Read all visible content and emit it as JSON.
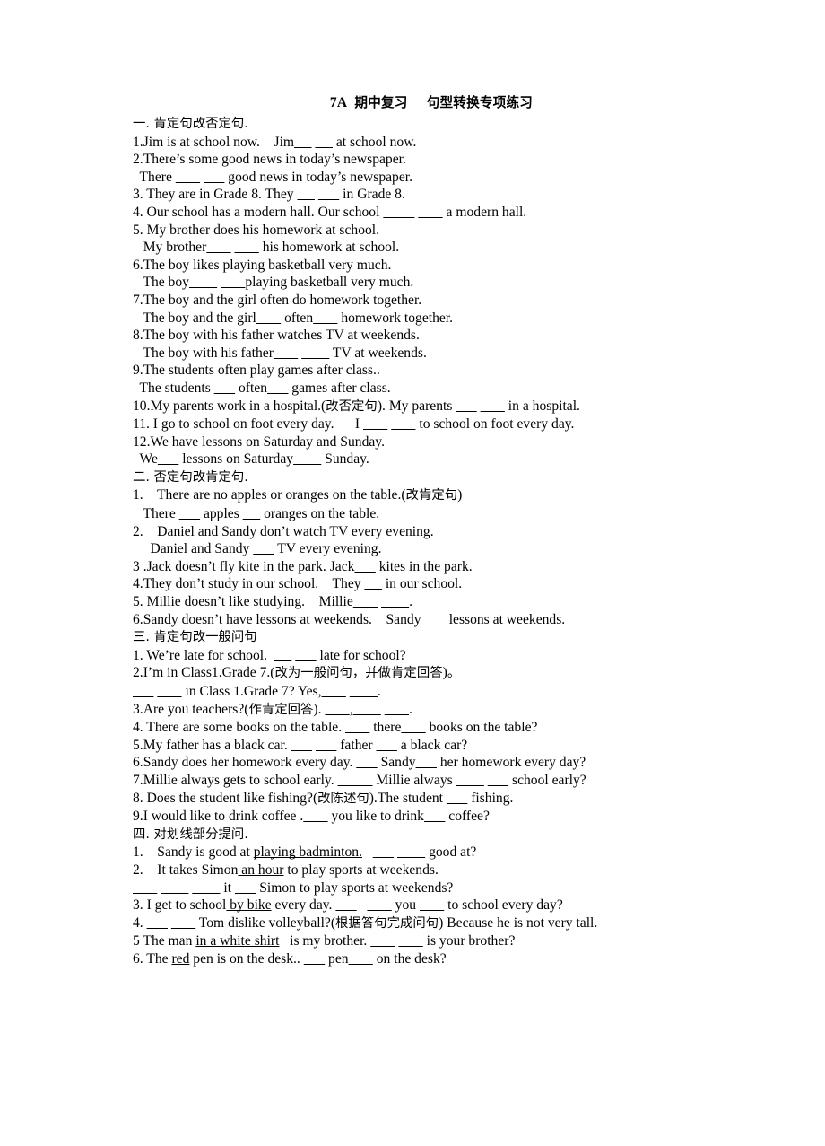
{
  "document": {
    "title": "7A  期中复习    句型转换专项练习",
    "title_prefix": "7A",
    "title_cn": "期中复习    句型转换专项练习"
  },
  "sections": [
    {
      "heading": "一. 肯定句改否定句.",
      "lines": [
        "1.Jim is at school now.    Jim_____ _____ at school now.",
        "2.There’s some good news in today’s newspaper.",
        "  There ______ ______ good news in today’s newspaper.",
        "3. They are in Grade 8. They _____ ______ in Grade 8.",
        "4. Our school has a modern hall. Our school ________ _______ a modern hall.",
        "5. My brother does his homework at school.",
        "   My brother_______ _______ his homework at school.",
        "6.The boy likes playing basketball very much.",
        "   The boy________ _______playing basketball very much.",
        "7.The boy and the girl often do homework together.",
        "   The boy and the girl_______ often_______ homework together.",
        "8.The boy with his father watches TV at weekends.",
        "   The boy with his father_______ ________ TV at weekends.",
        "9.The students often play games after class..",
        "  The students ______ often______ games after class.",
        "10.My parents work in a hospital.(改否定句). My parents ______ ______ in a hospital.",
        "11. I go to school on foot every day.      I _______ _______ to school on foot every day.",
        "12.We have lessons on Saturday and Sunday.",
        "  We_____ lessons on Saturday_______ Sunday."
      ]
    },
    {
      "heading": "二. 否定句改肯定句.",
      "lines": [
        "1.    There are no apples or oranges on the table.(改肯定句)",
        "   There ______ apples _____ oranges on the table.",
        "2.    Daniel and Sandy don’t watch TV every evening.",
        "     Daniel and Sandy ______ TV every evening.",
        "3 .Jack doesn’t fly kite in the park. Jack______ kites in the park.",
        "4.They don’t study in our school.    They _____ in our school.",
        "5. Millie doesn’t like studying.    Millie_______ ________.",
        "6.Sandy doesn’t have lessons at weekends.    Sandy_______ lessons at weekends."
      ]
    },
    {
      "heading": "三. 肯定句改一般问句",
      "lines": [
        "1. We’re late for school.  _____ ______ late for school?",
        "2.I’m in Class1.Grade 7.(改为一般问句，并做肯定回答)。",
        "______ _______ in Class 1.Grade 7? Yes,_______ ________.",
        "3.Are you teachers?(作肯定回答). _______,________ _______.",
        "4. There are some books on the table. _______ there_______ books on the table?",
        "5.My father has a black car. ______ ______ father ______ a black car?",
        "6.Sandy does her homework every day. ______ Sandy______ her homework every day?",
        "7.Millie always gets to school early. __________ Millie always ________ ______ school early?",
        "8. Does the student like fishing?(改陈述句).The student ______ fishing.",
        "9.I would like to drink coffee ._______ you like to drink______ coffee?"
      ]
    },
    {
      "heading": "四. 对划线部分提问.",
      "lines": [
        "1.    Sandy is good at playing badminton.   ______ ________ good at?",
        "2.    It takes Simon an hour to play sports at weekends.",
        "_______ ________ ________ it ______ Simon to play sports at weekends?",
        "3. I get to school by bike every day. ______   _______ you _______ to school every day?",
        "4. ______ _______ Tom dislike volleyball?(根据答句完成问句) Because he is not very tall.",
        "5 The man in a white shirt   is my brother. _______ _______ is your brother?",
        "6. The red pen is on the desk.. ______ pen_______ on the desk?"
      ],
      "underlined_phrases": [
        "playing badminton.",
        "an hour",
        "by bike",
        "in a white shirt",
        "red"
      ]
    }
  ]
}
